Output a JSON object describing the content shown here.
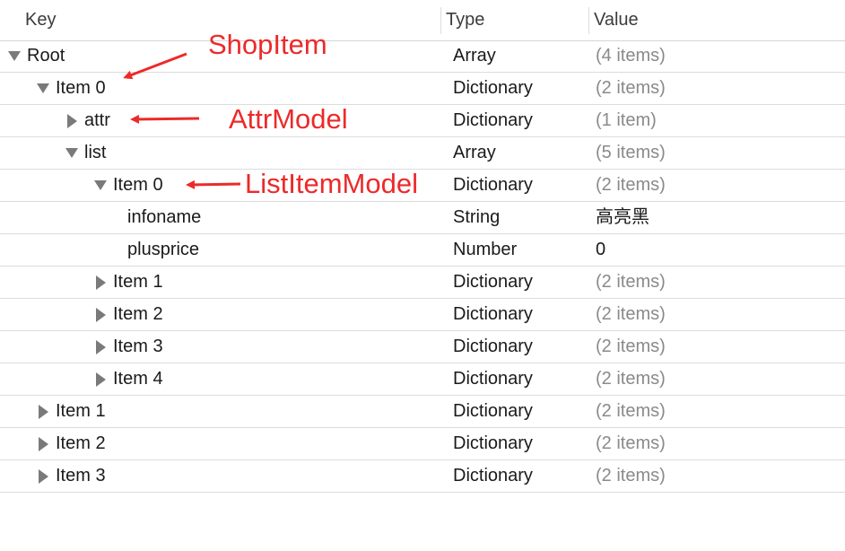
{
  "header": {
    "key": "Key",
    "type": "Type",
    "value": "Value"
  },
  "rows": [
    {
      "key": "Root",
      "type": "Array",
      "value": "(4 items)",
      "disclosure": "expanded",
      "muted": true
    },
    {
      "key": "Item 0",
      "type": "Dictionary",
      "value": "(2 items)",
      "disclosure": "expanded",
      "muted": true
    },
    {
      "key": "attr",
      "type": "Dictionary",
      "value": "(1 item)",
      "disclosure": "collapsed",
      "muted": true
    },
    {
      "key": "list",
      "type": "Array",
      "value": "(5 items)",
      "disclosure": "expanded",
      "muted": true
    },
    {
      "key": "Item 0",
      "type": "Dictionary",
      "value": "(2 items)",
      "disclosure": "expanded",
      "muted": true
    },
    {
      "key": "infoname",
      "type": "String",
      "value": "高亮黑",
      "disclosure": "none",
      "muted": false
    },
    {
      "key": "plusprice",
      "type": "Number",
      "value": "0",
      "disclosure": "none",
      "muted": false
    },
    {
      "key": "Item 1",
      "type": "Dictionary",
      "value": "(2 items)",
      "disclosure": "collapsed",
      "muted": true
    },
    {
      "key": "Item 2",
      "type": "Dictionary",
      "value": "(2 items)",
      "disclosure": "collapsed",
      "muted": true
    },
    {
      "key": "Item 3",
      "type": "Dictionary",
      "value": "(2 items)",
      "disclosure": "collapsed",
      "muted": true
    },
    {
      "key": "Item 4",
      "type": "Dictionary",
      "value": "(2 items)",
      "disclosure": "collapsed",
      "muted": true
    },
    {
      "key": "Item 1",
      "type": "Dictionary",
      "value": "(2 items)",
      "disclosure": "collapsed",
      "muted": true
    },
    {
      "key": "Item 2",
      "type": "Dictionary",
      "value": "(2 items)",
      "disclosure": "collapsed",
      "muted": true
    },
    {
      "key": "Item 3",
      "type": "Dictionary",
      "value": "(2 items)",
      "disclosure": "collapsed",
      "muted": true
    }
  ],
  "annotations": {
    "shop_item": "ShopItem",
    "attr_model": "AttrModel",
    "list_item_model": "ListItemModel"
  },
  "colors": {
    "annotation": "#ec2a2a",
    "muted_value": "#8a8a8a",
    "disclosure_triangle": "#7a7a7a"
  }
}
